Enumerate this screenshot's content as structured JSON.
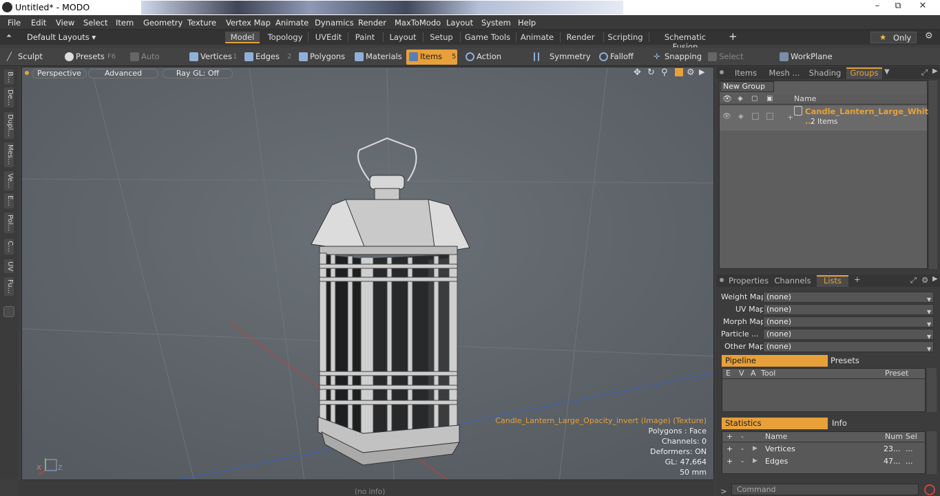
{
  "window": {
    "title": "Untitled* - MODO",
    "min": "–",
    "max": "⧉",
    "close": "✕"
  },
  "menu": [
    "File",
    "Edit",
    "View",
    "Select",
    "Item",
    "Geometry",
    "Texture",
    "Vertex Map",
    "Animate",
    "Dynamics",
    "Render",
    "MaxToModo",
    "Layout",
    "System",
    "Help"
  ],
  "layouts": {
    "label": "Default Layouts ▾",
    "tabs": [
      "Model",
      "Topology",
      "UVEdit",
      "Paint",
      "Layout",
      "Setup",
      "Game Tools",
      "Animate",
      "Render",
      "Scripting",
      "Schematic Fusion"
    ],
    "add": "+",
    "only": "Only",
    "star": "★",
    "active_tab": "Model"
  },
  "toolbar": {
    "sculpt": "Sculpt",
    "presets": "Presets",
    "presets_key": "F6",
    "auto_select": "Auto Select",
    "vertices": "Vertices",
    "vertices_n": "1",
    "edges": "Edges",
    "edges_n": "2",
    "polygons": "Polygons",
    "materials": "Materials",
    "items": "Items",
    "items_n": "5",
    "action_center": "Action Center",
    "symmetry": "Symmetry",
    "falloff": "Falloff",
    "snapping": "Snapping",
    "select_through": "Select Through",
    "workplane": "WorkPlane"
  },
  "left_tabs": [
    "B...",
    "De...",
    "Dupl...",
    "Mes...",
    "Ve...",
    "E...",
    "Pol...",
    "C...",
    "UV",
    "Fu..."
  ],
  "viewport": {
    "perspective": "Perspective",
    "advanced": "Advanced",
    "raygl": "Ray GL: Off",
    "stats": {
      "texture": "Candle_Lantern_Large_Opacity_invert (Image) (Texture)",
      "polygons": "Polygons : Face",
      "channels": "Channels: 0",
      "deformers": "Deformers: ON",
      "gl": "GL: 47,664",
      "scale": "50 mm"
    },
    "axis_x": "X",
    "axis_z": "Z"
  },
  "status": {
    "info": "(no info)"
  },
  "groups_panel": {
    "tabs": [
      "Items",
      "Mesh ...",
      "Shading",
      "Groups"
    ],
    "active": "Groups",
    "new_group": "New Group",
    "col_name": "Name",
    "group_name": "Candle_Lantern_Large_Whit ...",
    "group_count": "2 Items"
  },
  "lists_panel": {
    "tabs": [
      "Properties",
      "Channels",
      "Lists"
    ],
    "active": "Lists",
    "add": "+",
    "maps": [
      {
        "label": "Weight Map",
        "value": "(none)"
      },
      {
        "label": "UV Map",
        "value": "(none)"
      },
      {
        "label": "Morph Map",
        "value": "(none)"
      },
      {
        "label": "Particle ...",
        "value": "(none)"
      },
      {
        "label": "Other Map",
        "value": "(none)"
      }
    ]
  },
  "pipeline": {
    "tab": "Pipeline",
    "tab2": "Presets",
    "cols": [
      "E",
      "V",
      "A",
      "Tool",
      "Preset"
    ]
  },
  "statistics": {
    "tab": "Statistics",
    "tab2": "Info",
    "cols": [
      "+",
      "-",
      "Name",
      "Num",
      "Sel"
    ],
    "rows": [
      {
        "plus": "+",
        "minus": "-",
        "name": "Vertices",
        "num": "23...",
        "sel": "..."
      },
      {
        "plus": "+",
        "minus": "-",
        "name": "Edges",
        "num": "47...",
        "sel": "..."
      }
    ]
  },
  "command": {
    "prompt": ">",
    "placeholder": "Command"
  }
}
